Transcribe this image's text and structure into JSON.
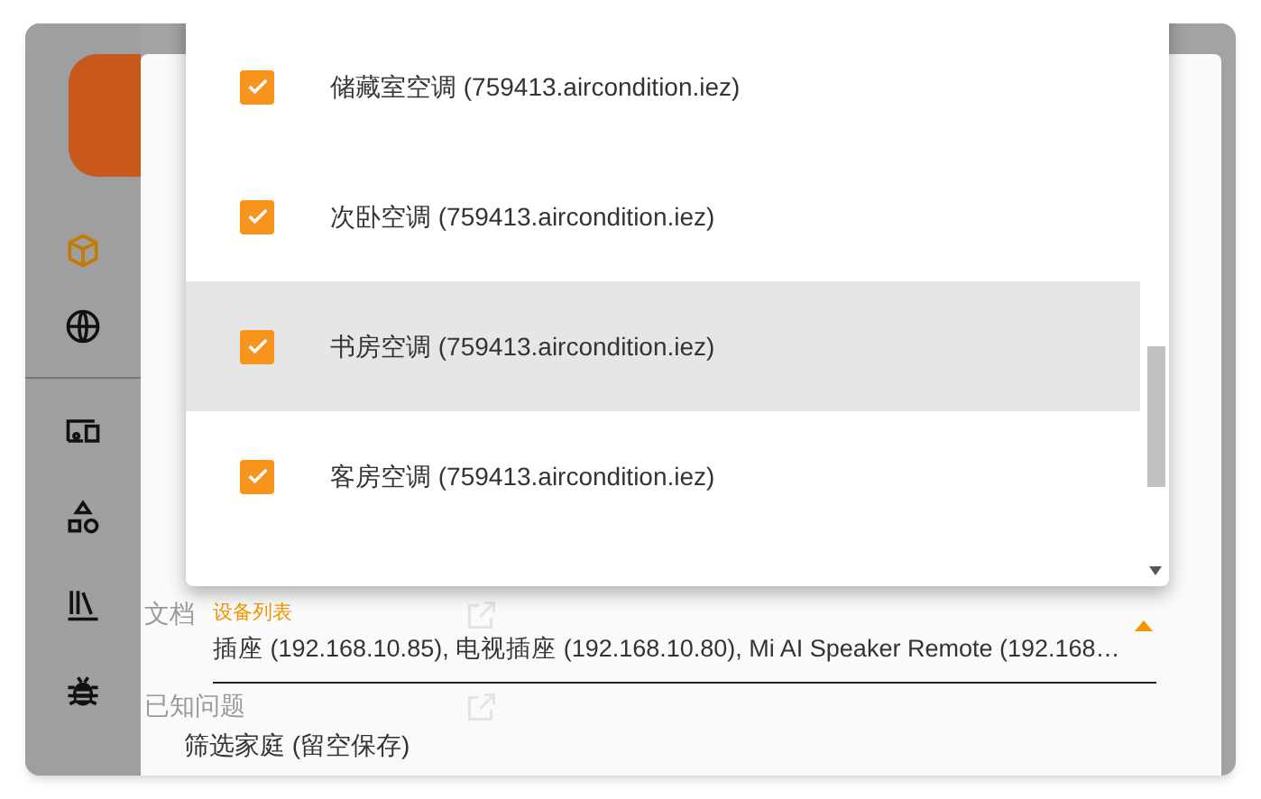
{
  "sidebar": {
    "items": [
      {
        "kind": "cube",
        "selected": true
      },
      {
        "kind": "globe",
        "selected": false
      },
      {
        "kind": "devices",
        "selected": false
      },
      {
        "kind": "shapes",
        "selected": false
      },
      {
        "kind": "library",
        "selected": false
      },
      {
        "kind": "bug",
        "selected": false
      }
    ]
  },
  "background_links": [
    {
      "label": "文档"
    },
    {
      "label": "已知问题"
    }
  ],
  "dropdown": {
    "options": [
      {
        "label": "储藏室空调 (759413.aircondition.iez)",
        "checked": true,
        "highlighted": false
      },
      {
        "label": "次卧空调 (759413.aircondition.iez)",
        "checked": true,
        "highlighted": false
      },
      {
        "label": "书房空调 (759413.aircondition.iez)",
        "checked": true,
        "highlighted": true
      },
      {
        "label": "客房空调 (759413.aircondition.iez)",
        "checked": true,
        "highlighted": false
      }
    ]
  },
  "device_field": {
    "label": "设备列表",
    "value": "插座 (192.168.10.85), 电视插座 (192.168.10.80), Mi AI Speaker Remote (192.168…",
    "expanded": true
  },
  "home_filter": {
    "label": "筛选家庭 (留空保存)"
  }
}
